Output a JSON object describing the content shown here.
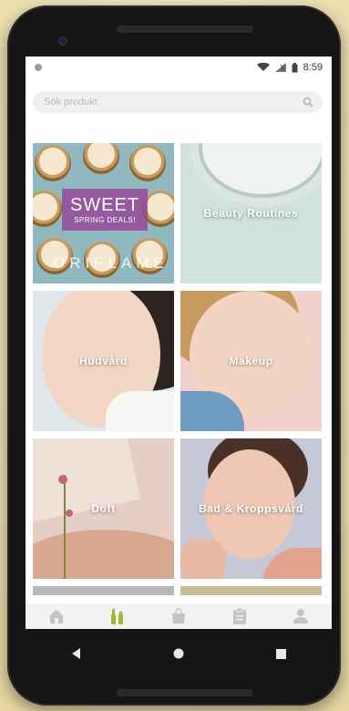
{
  "status_bar": {
    "time": "8:59"
  },
  "search": {
    "placeholder": "Sök produkt"
  },
  "promo": {
    "title": "SWEET",
    "subtitle": "SPRING DEALS!",
    "brand": "ORIFLAME"
  },
  "categories": [
    {
      "label": "Beauty Routines"
    },
    {
      "label": "Hudvård"
    },
    {
      "label": "Makeup"
    },
    {
      "label": "Doft"
    },
    {
      "label": "Bad & Kroppsvård"
    }
  ],
  "bottom_nav": {
    "items": [
      {
        "icon": "home-icon",
        "active": false
      },
      {
        "icon": "makeup-brush-icon",
        "active": true
      },
      {
        "icon": "shopping-bag-icon",
        "active": false
      },
      {
        "icon": "clipboard-icon",
        "active": false
      },
      {
        "icon": "profile-icon",
        "active": false
      }
    ],
    "active_color": "#a6b52b",
    "inactive_color": "#c4c4c4"
  },
  "system_nav": {
    "buttons": [
      "back-icon",
      "home-circle-icon",
      "recents-icon"
    ]
  }
}
